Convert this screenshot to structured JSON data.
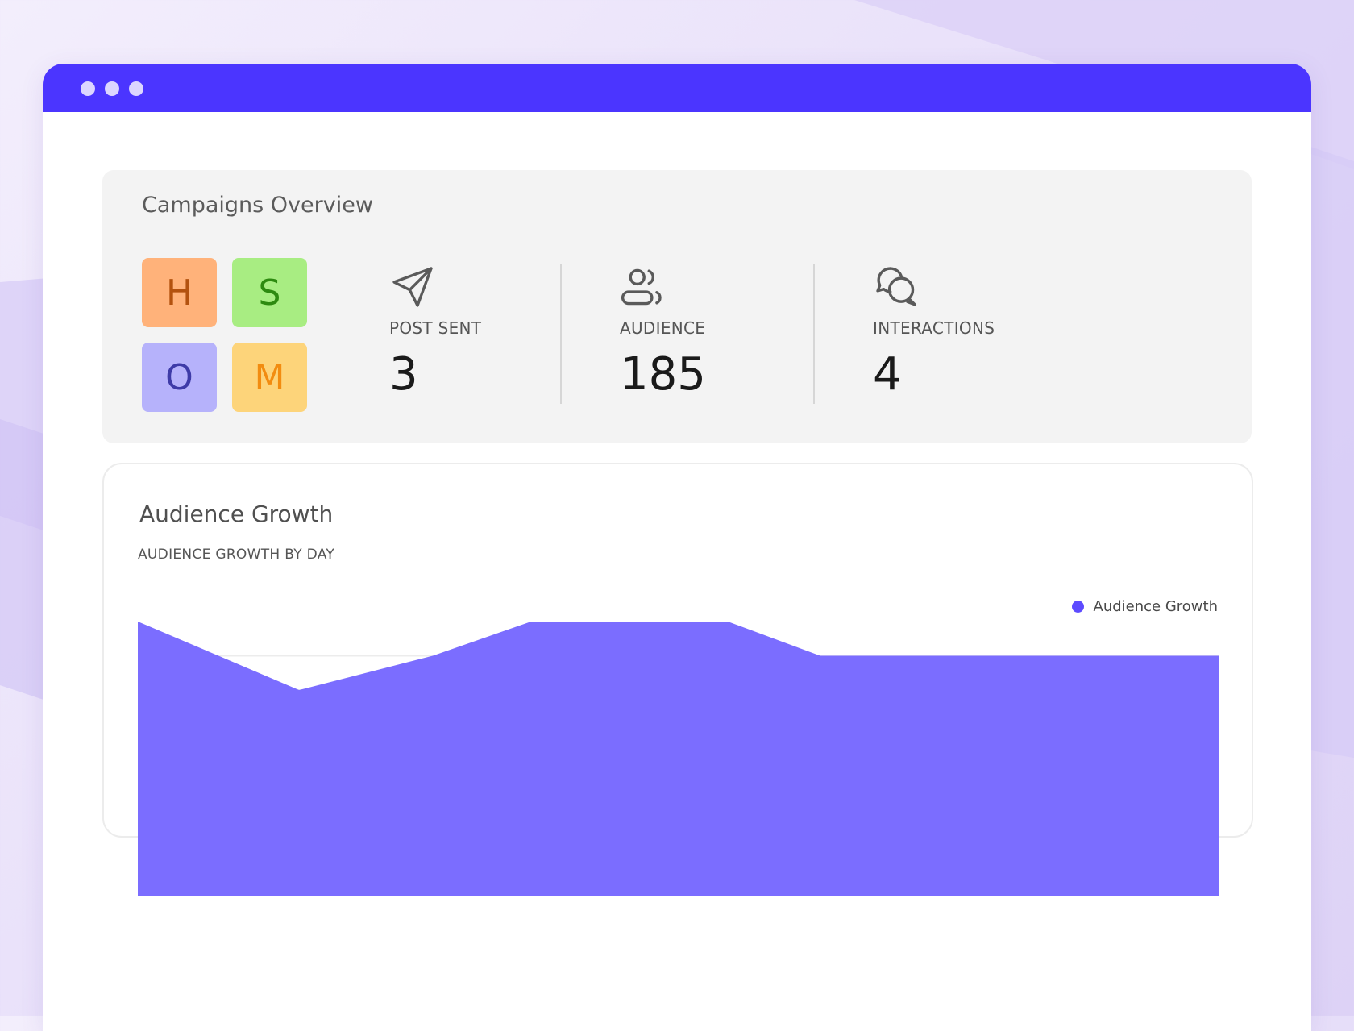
{
  "window": {
    "titlebar_color": "#4b35ff",
    "controls": [
      "window-dot",
      "window-dot",
      "window-dot"
    ]
  },
  "overview": {
    "title": "Campaigns Overview",
    "tiles": [
      {
        "letter": "H",
        "bg": "#ffb27a",
        "fg": "#b3520f"
      },
      {
        "letter": "S",
        "bg": "#a8ed82",
        "fg": "#2d8a10"
      },
      {
        "letter": "O",
        "bg": "#b6b2fb",
        "fg": "#3e3ba8"
      },
      {
        "letter": "M",
        "bg": "#fdd47a",
        "fg": "#f28c10"
      }
    ],
    "stats": [
      {
        "icon": "paper-plane-icon",
        "label": "POST SENT",
        "value": "3"
      },
      {
        "icon": "users-icon",
        "label": "AUDIENCE",
        "value": "185"
      },
      {
        "icon": "chat-bubbles-icon",
        "label": "INTERACTIONS",
        "value": "4"
      }
    ]
  },
  "growth": {
    "title": "Audience Growth",
    "subtitle": "AUDIENCE GROWTH BY DAY",
    "legend_label": "Audience Growth",
    "series_color": "#5d4bff",
    "fill_color": "#7b6dff"
  },
  "chart_data": {
    "type": "area",
    "title": "",
    "xlabel": "",
    "ylabel": "",
    "ylim": [
      0,
      8
    ],
    "grid": true,
    "legend_position": "top-right",
    "series": [
      {
        "name": "Audience Growth",
        "values": [
          8,
          6,
          7,
          8,
          8,
          8,
          7,
          7,
          7,
          7,
          7,
          7
        ]
      }
    ],
    "x_index": [
      0,
      1.64,
      3.0,
      4.0,
      5.0,
      6.0,
      6.94,
      8.0,
      9.0,
      10.0,
      11.0,
      10.45
    ]
  }
}
